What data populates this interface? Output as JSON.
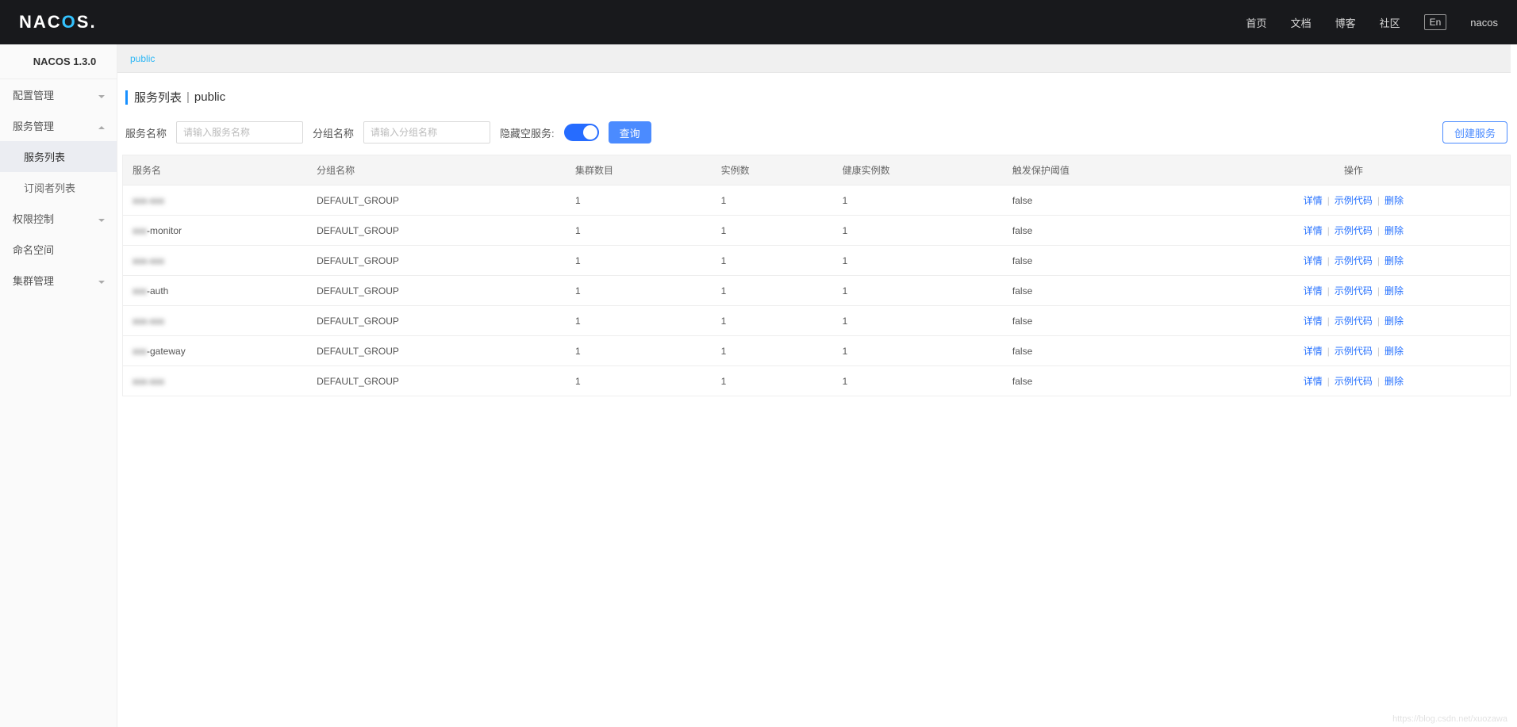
{
  "header": {
    "logo_prefix": "NAC",
    "logo_accent": "O",
    "logo_suffix": "S.",
    "nav_home": "首页",
    "nav_docs": "文档",
    "nav_blog": "博客",
    "nav_community": "社区",
    "lang": "En",
    "user": "nacos"
  },
  "sidebar": {
    "brand": "NACOS 1.3.0",
    "items": [
      {
        "label": "配置管理",
        "expandable": true,
        "expanded": false
      },
      {
        "label": "服务管理",
        "expandable": true,
        "expanded": true,
        "children": [
          {
            "label": "服务列表",
            "selected": true
          },
          {
            "label": "订阅者列表",
            "selected": false
          }
        ]
      },
      {
        "label": "权限控制",
        "expandable": true,
        "expanded": false
      },
      {
        "label": "命名空间",
        "expandable": false
      },
      {
        "label": "集群管理",
        "expandable": true,
        "expanded": false
      }
    ]
  },
  "namespace": {
    "active": "public"
  },
  "page": {
    "title_main": "服务列表",
    "title_sep": "|",
    "title_sub": "public"
  },
  "filters": {
    "service_name_label": "服务名称",
    "service_name_placeholder": "请输入服务名称",
    "group_name_label": "分组名称",
    "group_name_placeholder": "请输入分组名称",
    "hide_empty_label": "隐藏空服务:",
    "hide_empty_on": true,
    "query_btn": "查询",
    "create_btn": "创建服务"
  },
  "table": {
    "columns": {
      "service_name": "服务名",
      "group_name": "分组名称",
      "cluster_count": "集群数目",
      "instance_count": "实例数",
      "healthy_instance_count": "健康实例数",
      "trigger_threshold": "触发保护阈值",
      "operations": "操作"
    },
    "ops": {
      "detail": "详情",
      "sample": "示例代码",
      "delete": "删除"
    },
    "rows": [
      {
        "service_name": "xxx-xxx",
        "blurred": true,
        "group_name": "DEFAULT_GROUP",
        "cluster_count": "1",
        "instance_count": "1",
        "healthy_instance_count": "1",
        "trigger_threshold": "false"
      },
      {
        "service_name": "xxx-monitor",
        "blurred_partial": true,
        "group_name": "DEFAULT_GROUP",
        "cluster_count": "1",
        "instance_count": "1",
        "healthy_instance_count": "1",
        "trigger_threshold": "false"
      },
      {
        "service_name": "xxx-xxx",
        "blurred": true,
        "group_name": "DEFAULT_GROUP",
        "cluster_count": "1",
        "instance_count": "1",
        "healthy_instance_count": "1",
        "trigger_threshold": "false"
      },
      {
        "service_name": "xxx-auth",
        "blurred_partial": true,
        "group_name": "DEFAULT_GROUP",
        "cluster_count": "1",
        "instance_count": "1",
        "healthy_instance_count": "1",
        "trigger_threshold": "false"
      },
      {
        "service_name": "xxx-xxx",
        "blurred": true,
        "group_name": "DEFAULT_GROUP",
        "cluster_count": "1",
        "instance_count": "1",
        "healthy_instance_count": "1",
        "trigger_threshold": "false"
      },
      {
        "service_name": "xxx-gateway",
        "blurred_partial": true,
        "group_name": "DEFAULT_GROUP",
        "cluster_count": "1",
        "instance_count": "1",
        "healthy_instance_count": "1",
        "trigger_threshold": "false"
      },
      {
        "service_name": "xxx-xxx",
        "blurred": true,
        "group_name": "DEFAULT_GROUP",
        "cluster_count": "1",
        "instance_count": "1",
        "healthy_instance_count": "1",
        "trigger_threshold": "false"
      }
    ]
  },
  "watermark": "https://blog.csdn.net/xuozawa"
}
